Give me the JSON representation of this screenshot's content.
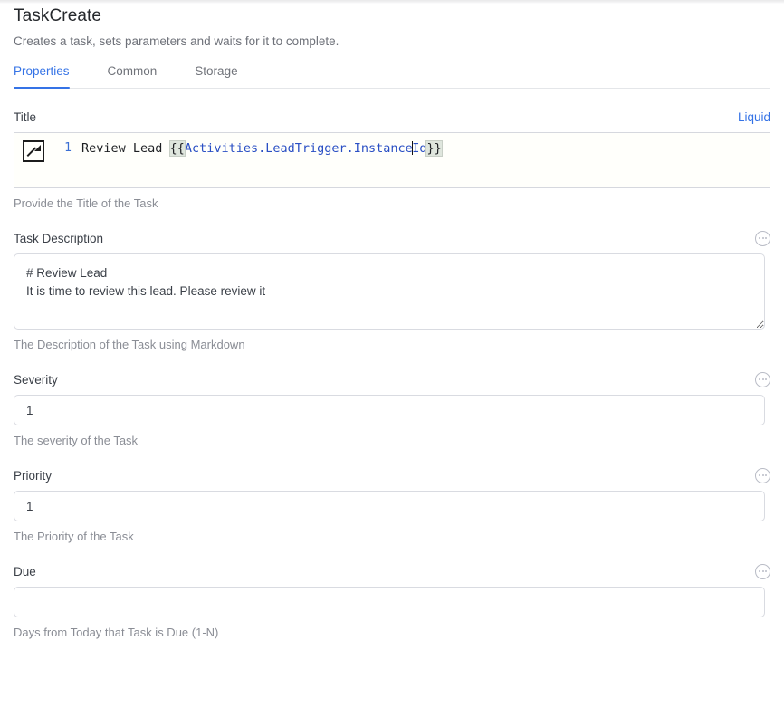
{
  "header": {
    "title": "TaskCreate",
    "subtitle": "Creates a task, sets parameters and waits for it to complete."
  },
  "tabs": [
    {
      "label": "Properties",
      "active": true
    },
    {
      "label": "Common",
      "active": false
    },
    {
      "label": "Storage",
      "active": false
    }
  ],
  "fields": {
    "title": {
      "label": "Title",
      "liquid_label": "Liquid",
      "line_number": "1",
      "code_plain": "Review Lead ",
      "code_open_brace": "{{",
      "code_variable_a": "Activities.LeadTrigger.Instance",
      "code_variable_b": "Id",
      "code_close_brace": "}}",
      "hint": "Provide the Title of the Task",
      "expand_icon": "open-in-new-icon"
    },
    "description": {
      "label": "Task Description",
      "value": "# Review Lead\nIt is time to review this lead. Please review it",
      "hint": "The Description of the Task using Markdown",
      "menu_icon": "ellipsis-circle-icon"
    },
    "severity": {
      "label": "Severity",
      "value": "1",
      "hint": "The severity of the Task",
      "menu_icon": "ellipsis-circle-icon"
    },
    "priority": {
      "label": "Priority",
      "value": "1",
      "hint": "The Priority of the Task",
      "menu_icon": "ellipsis-circle-icon"
    },
    "due": {
      "label": "Due",
      "value": "",
      "hint": "Days from Today that Task is Due (1-N)",
      "menu_icon": "ellipsis-circle-icon"
    }
  },
  "colors": {
    "accent": "#3573e6",
    "label": "#3b4048",
    "hint": "#8a8d95",
    "border": "#d9dbe1",
    "code_variable": "#2a4fc4",
    "brace_highlight": "#dfe6dd"
  }
}
